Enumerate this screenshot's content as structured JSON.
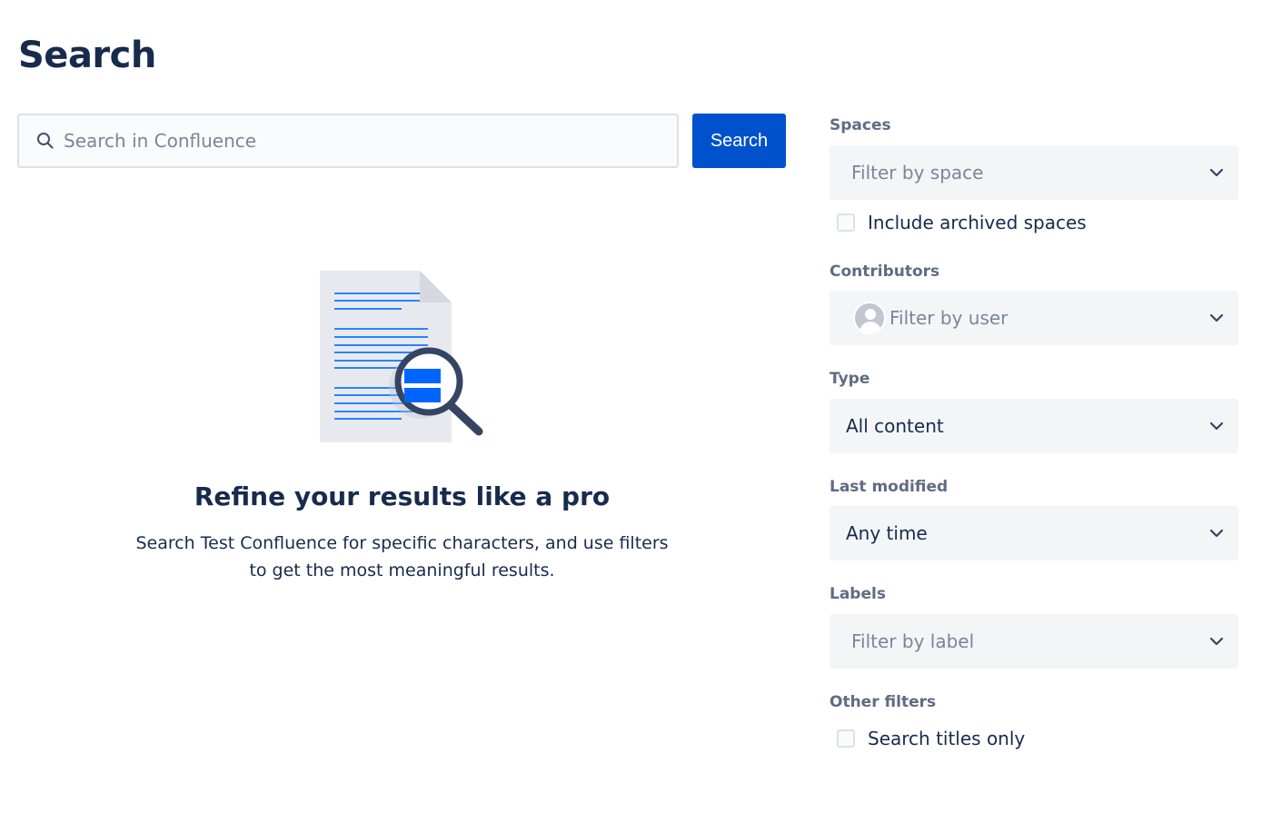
{
  "page": {
    "title": "Search"
  },
  "search": {
    "placeholder": "Search in Confluence",
    "value": "",
    "button_label": "Search"
  },
  "empty_state": {
    "heading": "Refine your results like a pro",
    "description": "Search Test Confluence for specific characters, and use filters to get the most meaningful results."
  },
  "filters": {
    "spaces": {
      "label": "Spaces",
      "placeholder": "Filter by space",
      "archived_label": "Include archived spaces",
      "archived_checked": false
    },
    "contributors": {
      "label": "Contributors",
      "placeholder": "Filter by user"
    },
    "type": {
      "label": "Type",
      "value": "All content"
    },
    "last_modified": {
      "label": "Last modified",
      "value": "Any time"
    },
    "labels": {
      "label": "Labels",
      "placeholder": "Filter by label"
    },
    "other": {
      "label": "Other filters",
      "titles_only_label": "Search titles only",
      "titles_only_checked": false
    }
  },
  "colors": {
    "primary": "#0052cc",
    "text": "#172b4d",
    "subtle": "#5e6c84",
    "field_bg": "#f4f5f7"
  }
}
